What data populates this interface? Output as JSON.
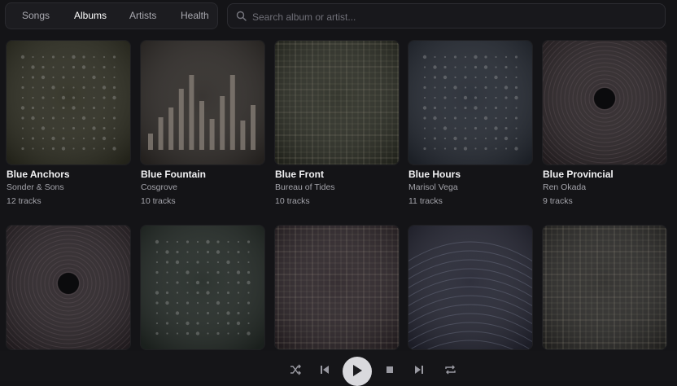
{
  "tabs": [
    {
      "label": "Songs",
      "active": false
    },
    {
      "label": "Albums",
      "active": true
    },
    {
      "label": "Artists",
      "active": false
    },
    {
      "label": "Health",
      "active": false
    }
  ],
  "search": {
    "placeholder": "Search album or artist..."
  },
  "albums": [
    {
      "title": "Blue Anchors",
      "artist": "Sonder & Sons",
      "tracks": "12 tracks",
      "cover": "dots",
      "tint": "#2e2e22"
    },
    {
      "title": "Blue Fountain",
      "artist": "Cosgrove",
      "tracks": "10 tracks",
      "cover": "bars",
      "tint": "#2f2b28"
    },
    {
      "title": "Blue Front",
      "artist": "Bureau of Tides",
      "tracks": "10 tracks",
      "cover": "grid",
      "tint": "#2b2d24"
    },
    {
      "title": "Blue Hours",
      "artist": "Marisol Vega",
      "tracks": "11 tracks",
      "cover": "dots",
      "tint": "#252a33"
    },
    {
      "title": "Blue Provincial",
      "artist": "Ren Okada",
      "tracks": "9 tracks",
      "cover": "rings",
      "tint": "#2b2427"
    },
    {
      "title": "",
      "artist": "",
      "tracks": "",
      "cover": "rings",
      "tint": "#2b2428"
    },
    {
      "title": "",
      "artist": "",
      "tracks": "",
      "cover": "dots",
      "tint": "#232a26"
    },
    {
      "title": "",
      "artist": "",
      "tracks": "",
      "cover": "grid",
      "tint": "#2c2428"
    },
    {
      "title": "",
      "artist": "",
      "tracks": "",
      "cover": "arcs",
      "tint": "#252633"
    },
    {
      "title": "",
      "artist": "",
      "tracks": "",
      "cover": "grid",
      "tint": "#2b2a28"
    }
  ],
  "player": {
    "controls": [
      "shuffle-icon",
      "previous-icon",
      "play-icon",
      "stop-icon",
      "next-icon",
      "repeat-icon"
    ]
  }
}
